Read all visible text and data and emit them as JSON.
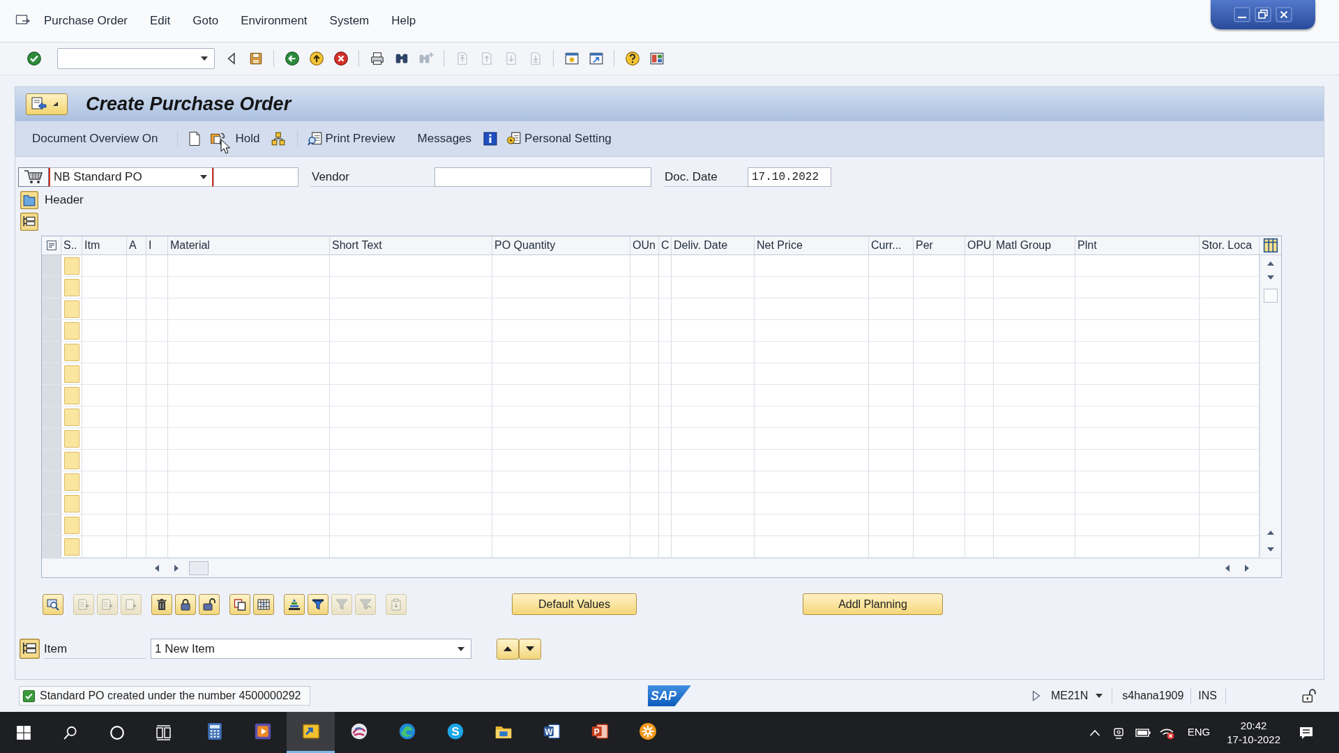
{
  "menu_bar": [
    "Purchase Order",
    "Edit",
    "Goto",
    "Environment",
    "System",
    "Help"
  ],
  "toolbar": {
    "icons": [
      {
        "disabled": false
      },
      {
        "disabled": false
      },
      {
        "disabled": false
      },
      {
        "disabled": false
      },
      {
        "disabled": false
      },
      {
        "disabled": false
      },
      {
        "disabled": false
      },
      {
        "disabled": false
      },
      {
        "disabled": true
      },
      {
        "disabled": true
      },
      {
        "disabled": true
      },
      {
        "disabled": true
      },
      {
        "disabled": true
      },
      {
        "disabled": false
      },
      {
        "disabled": false
      },
      {
        "disabled": false
      },
      {
        "disabled": false
      }
    ]
  },
  "title": "Create Purchase Order",
  "app_toolbar": {
    "buttons": [
      {
        "label": "Document Overview On"
      },
      {
        "label": "Hold"
      },
      {
        "label": "Print Preview"
      },
      {
        "label": "Messages"
      },
      {
        "label": "Personal Setting"
      }
    ]
  },
  "header_fields": {
    "order_type": {
      "value": "NB Standard PO",
      "focused": true
    },
    "vendor": {
      "label": "Vendor"
    },
    "doc_date": {
      "label": "Doc. Date",
      "value": "17.10.2022"
    }
  },
  "header_section": {
    "label": "Header"
  },
  "items_table": {
    "columns": [
      "S..",
      "Itm",
      "A",
      "I",
      "Material",
      "Short Text",
      "PO Quantity",
      "OUn",
      "C",
      "Deliv. Date",
      "Net Price",
      "Curr...",
      "Per",
      "OPU",
      "Matl Group",
      "Plnt",
      "Stor. Loca"
    ]
  },
  "table_tools": [
    {
      "disabled": false
    },
    {
      "disabled": true
    },
    {
      "disabled": true
    },
    {
      "disabled": true
    },
    {
      "disabled": false
    },
    {
      "disabled": false
    },
    {
      "disabled": false
    },
    {
      "disabled": false
    },
    {
      "disabled": false
    },
    {
      "disabled": false
    },
    {
      "disabled": false
    },
    {
      "disabled": true
    },
    {
      "disabled": true
    },
    {
      "disabled": true
    }
  ],
  "action_buttons": [
    {
      "label": "Default Values"
    },
    {
      "label": "Addl Planning"
    }
  ],
  "item_selector": {
    "label": "Item",
    "value": "1 New Item"
  },
  "status_bar": {
    "message": {
      "kind": "success",
      "text": "Standard PO created under the number 4500000292"
    },
    "logo": "SAP",
    "transaction": "ME21N",
    "system": "s4hana1909",
    "mode": "INS"
  },
  "taskbar": {
    "apps": [
      {
        "selected": false
      },
      {
        "selected": false
      },
      {
        "selected": true
      },
      {
        "selected": false
      },
      {
        "selected": false
      },
      {
        "selected": false,
        "letter": "S"
      },
      {
        "selected": false
      },
      {
        "selected": false,
        "letter": "W"
      },
      {
        "selected": false,
        "letter": "P"
      },
      {
        "selected": false
      }
    ],
    "language": "ENG",
    "time": "20:42",
    "date": "17-10-2022"
  }
}
